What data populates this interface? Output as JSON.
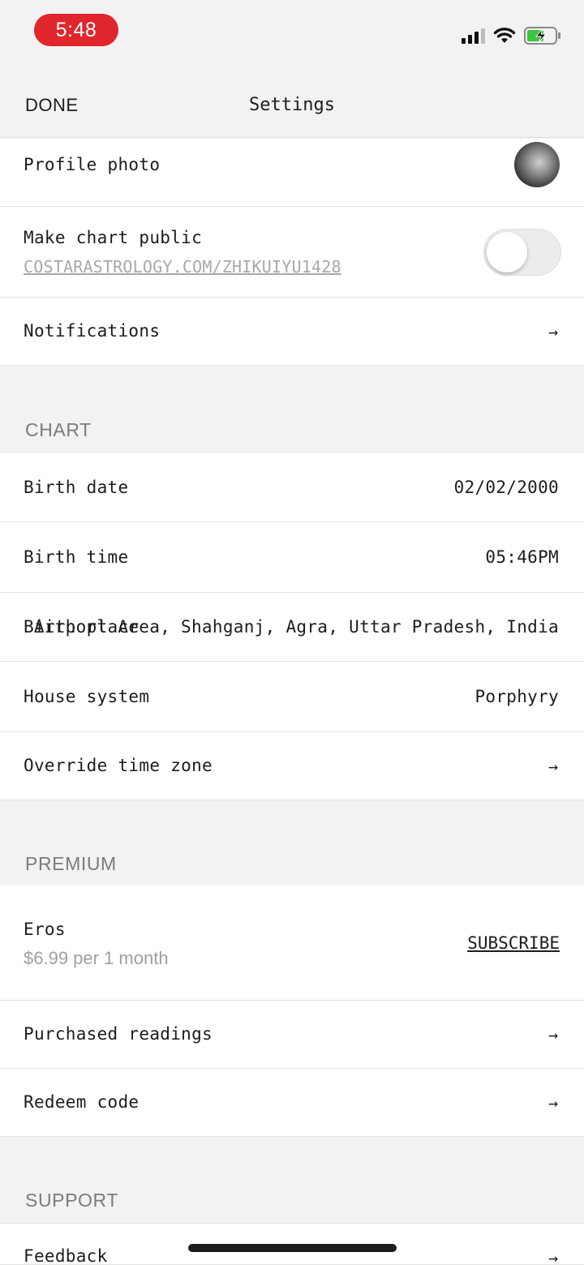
{
  "status_bar": {
    "time": "5:48"
  },
  "nav": {
    "done_label": "DONE",
    "title": "Settings"
  },
  "account": {
    "profile_photo_label": "Profile photo",
    "make_public_label": "Make chart public",
    "public_url": "COSTARASTROLOGY.COM/ZHIKUIYU1428",
    "public_toggle_on": false,
    "notifications_label": "Notifications"
  },
  "chart_section": {
    "header": "CHART",
    "birth_date_label": "Birth date",
    "birth_date_value": "02/02/2000",
    "birth_time_label": "Birth time",
    "birth_time_value": "05:46PM",
    "birth_place_label": "Birth place",
    "birth_place_value": "Airport Area, Shahganj, Agra, Uttar Pradesh, India",
    "house_system_label": "House system",
    "house_system_value": "Porphyry",
    "override_tz_label": "Override time zone"
  },
  "premium_section": {
    "header": "PREMIUM",
    "eros_label": "Eros",
    "eros_price": "$6.99 per 1 month",
    "subscribe_label": "SUBSCRIBE",
    "purchased_label": "Purchased readings",
    "redeem_label": "Redeem code"
  },
  "support_section": {
    "header": "SUPPORT",
    "feedback_label": "Feedback"
  },
  "arrow_glyph": "→",
  "colors": {
    "time_pill": "#e0262c",
    "background": "#f2f2f4",
    "muted": "#a8a8ac"
  }
}
